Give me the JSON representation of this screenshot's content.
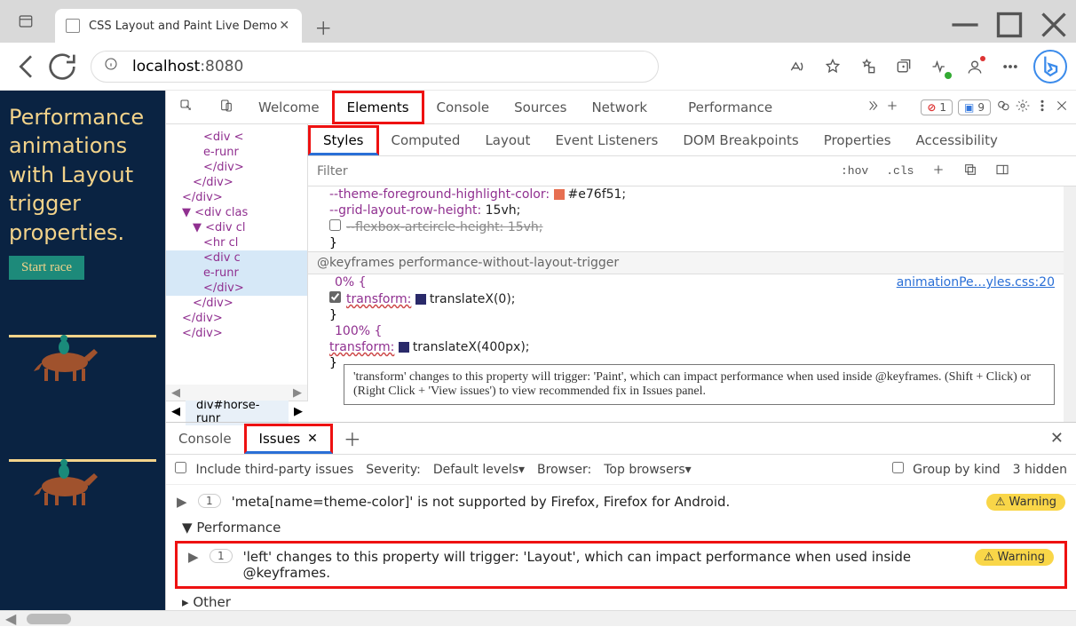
{
  "tab": {
    "title": "CSS Layout and Paint Live Demo"
  },
  "url": {
    "host": "localhost",
    "port": ":8080"
  },
  "page": {
    "heading": "Performance animations with Layout trigger properties.",
    "button": "Start race"
  },
  "devtools": {
    "tabs": [
      "Welcome",
      "Elements",
      "Console",
      "Sources",
      "Network",
      "Performance"
    ],
    "errors": "1",
    "messages": "9",
    "dom_lines": [
      {
        "t": "<div <",
        "c": "ind3"
      },
      {
        "t": "e-runr",
        "c": "ind3"
      },
      {
        "t": "</div>",
        "c": "ind3"
      },
      {
        "t": "</div>",
        "c": "ind2"
      },
      {
        "t": "</div>",
        "c": "ind1"
      },
      {
        "t": "▼ <div clas",
        "c": "ind1"
      },
      {
        "t": "▼ <div cl",
        "c": "ind2"
      },
      {
        "t": "<hr cl",
        "c": "ind3"
      },
      {
        "t": "<div c",
        "c": "ind3 sel"
      },
      {
        "t": "e-runr",
        "c": "ind3 sel"
      },
      {
        "t": "</div>",
        "c": "ind3 sel"
      },
      {
        "t": "</div>",
        "c": "ind2"
      },
      {
        "t": "</div>",
        "c": "ind1"
      },
      {
        "t": "</div>",
        "c": "ind1"
      }
    ],
    "breadcrumb": "div#horse-runr",
    "subtabs": [
      "Styles",
      "Computed",
      "Layout",
      "Event Listeners",
      "DOM Breakpoints",
      "Properties",
      "Accessibility"
    ],
    "filter_placeholder": "Filter",
    "hov": ":hov",
    "cls": ".cls",
    "styles": {
      "l1_prop": "--theme-foreground-highlight-color:",
      "l1_val": "#e76f51;",
      "l2_prop": "--grid-layout-row-height:",
      "l2_val": "15vh;",
      "l3": "--flexbox-artcircle-height: 15vh;",
      "kf_header": "@keyframes performance-without-layout-trigger",
      "pct0": "0% {",
      "link": "animationPe…yles.css:20",
      "p0_prop": "transform:",
      "p0_val": "translateX(0);",
      "pct100": "100% {",
      "p1_prop": "transform:",
      "p1_val": "translateX(400px);"
    },
    "tooltip": "'transform' changes to this property will trigger: 'Paint', which can impact performance when used inside @keyframes. (Shift + Click) or (Right Click + 'View issues') to view recommended fix in Issues panel."
  },
  "drawer": {
    "tabs": [
      "Console",
      "Issues"
    ],
    "include_label": "Include third-party issues",
    "severity_label": "Severity:",
    "severity_val": "Default levels",
    "browser_label": "Browser:",
    "browser_val": "Top browsers",
    "group_label": "Group by kind",
    "hidden": "3 hidden",
    "issue1": {
      "count": "1",
      "text": "'meta[name=theme-color]' is not supported by Firefox, Firefox for Android.",
      "badge": "Warning"
    },
    "cat": "Performance",
    "issue2": {
      "count": "1",
      "text": "'left' changes to this property will trigger: 'Layout', which can impact performance when used inside @keyframes.",
      "badge": "Warning"
    },
    "other": "Other"
  }
}
